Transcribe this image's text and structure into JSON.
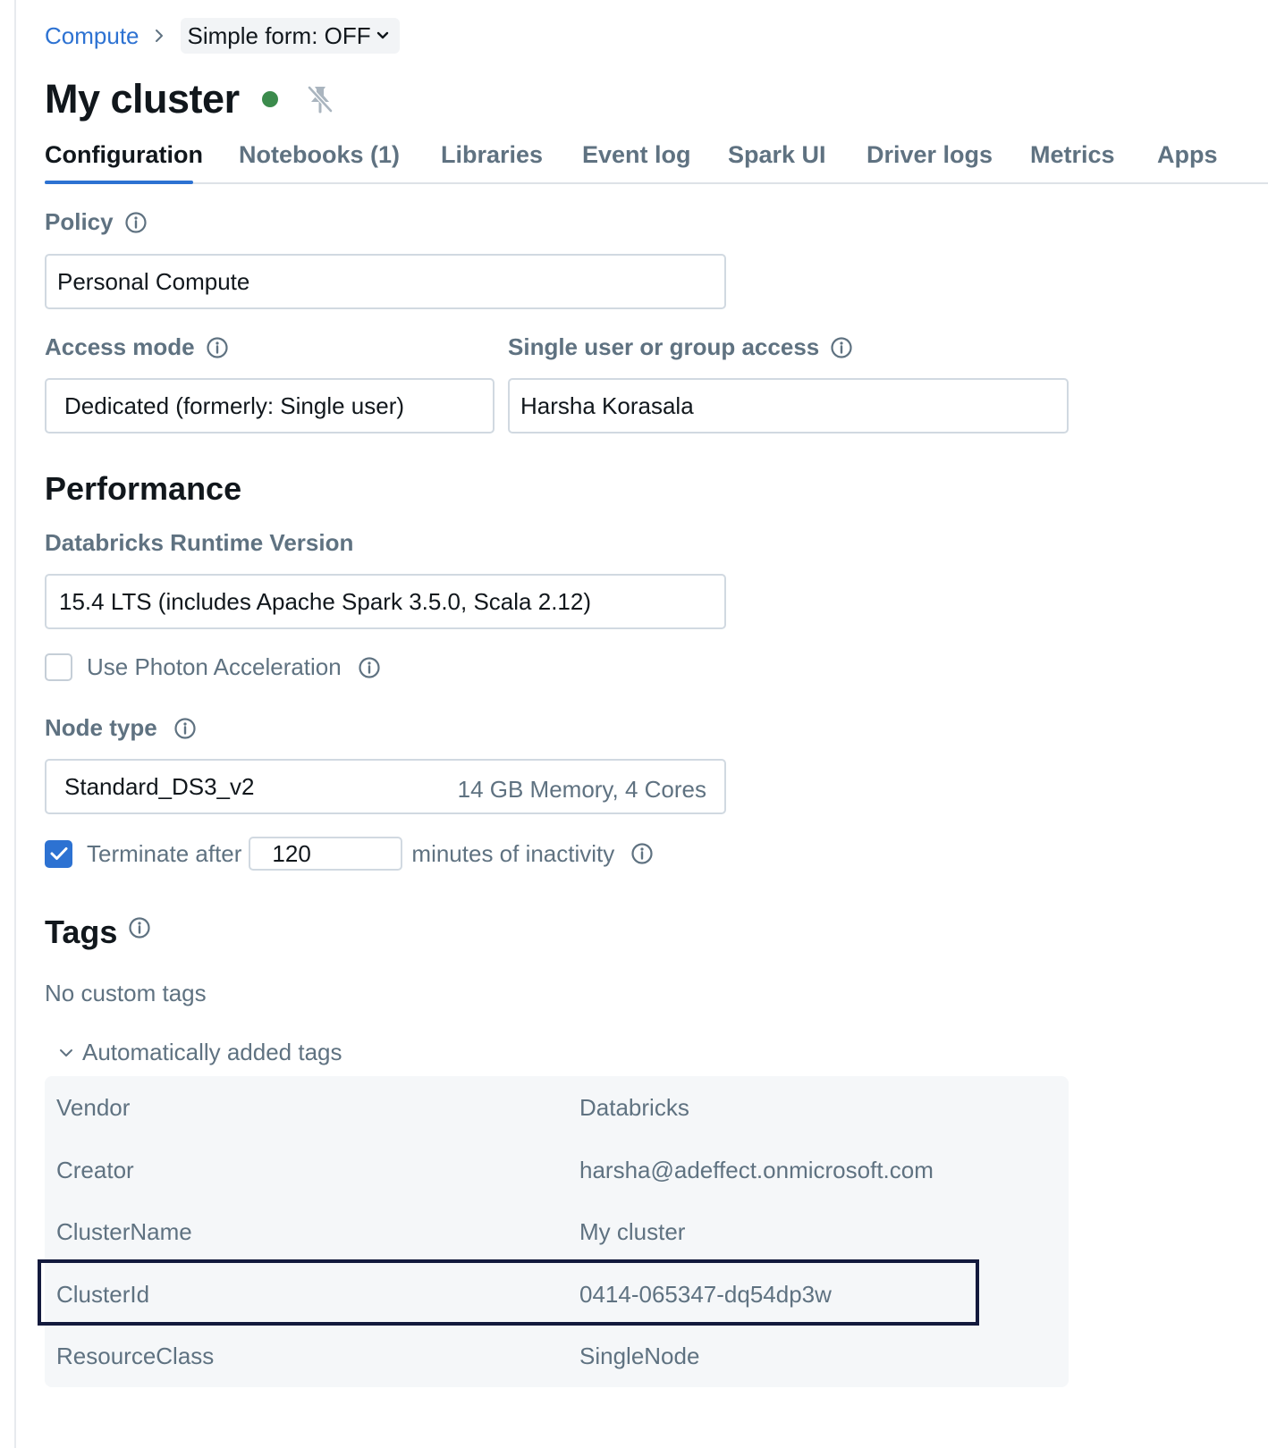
{
  "breadcrumb": {
    "link": "Compute",
    "form_toggle": "Simple form: OFF"
  },
  "header": {
    "title": "My cluster",
    "status_color": "#3b8b4c"
  },
  "tabs": [
    {
      "label": "Configuration",
      "active": true
    },
    {
      "label": "Notebooks (1)"
    },
    {
      "label": "Libraries"
    },
    {
      "label": "Event log"
    },
    {
      "label": "Spark UI"
    },
    {
      "label": "Driver logs"
    },
    {
      "label": "Metrics"
    },
    {
      "label": "Apps"
    }
  ],
  "policy": {
    "label": "Policy",
    "value": "Personal Compute"
  },
  "access_mode": {
    "label": "Access mode",
    "value": "Dedicated (formerly: Single user)"
  },
  "single_user": {
    "label": "Single user or group access",
    "value": "Harsha Korasala"
  },
  "performance": {
    "heading": "Performance",
    "runtime_label": "Databricks Runtime Version",
    "runtime_value": "15.4 LTS (includes Apache Spark 3.5.0, Scala 2.12)",
    "photon_label": "Use Photon Acceleration",
    "photon_checked": false,
    "node_type_label": "Node type",
    "node_type_value": "Standard_DS3_v2",
    "node_type_meta": "14 GB Memory, 4 Cores",
    "terminate_prefix": "Terminate after",
    "terminate_minutes": "120",
    "terminate_suffix": "minutes of inactivity",
    "terminate_checked": true
  },
  "tags": {
    "heading": "Tags",
    "empty_text": "No custom tags",
    "auto_toggle": "Automatically added tags",
    "rows": [
      {
        "key": "Vendor",
        "value": "Databricks"
      },
      {
        "key": "Creator",
        "value": "harsha@adeffect.onmicrosoft.com"
      },
      {
        "key": "ClusterName",
        "value": "My cluster"
      },
      {
        "key": "ClusterId",
        "value": "0414-065347-dq54dp3w"
      },
      {
        "key": "ResourceClass",
        "value": "SingleNode"
      }
    ]
  },
  "colors": {
    "accent": "#2d72d2",
    "text_secondary": "#5f7281",
    "highlight_border": "#131a3d"
  }
}
